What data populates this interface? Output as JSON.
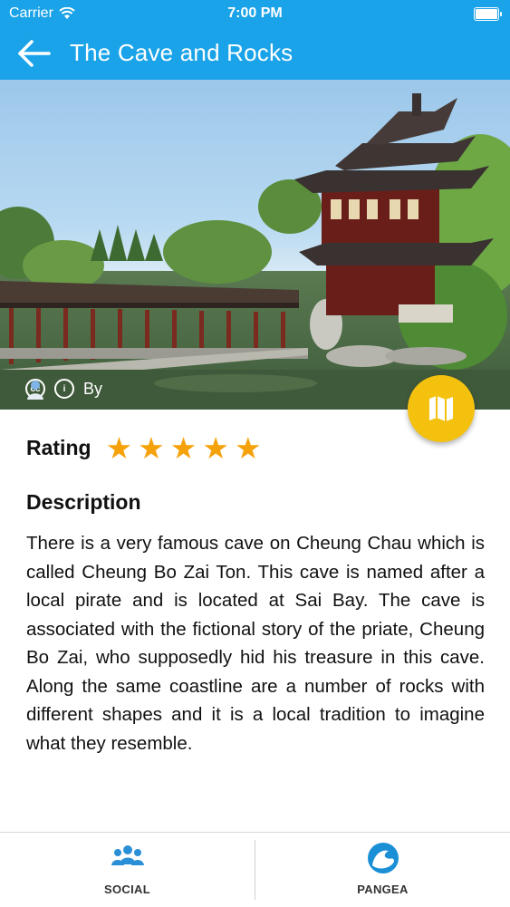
{
  "status_bar": {
    "carrier": "Carrier",
    "time": "7:00 PM",
    "icons": [
      "wifi-icon",
      "battery-icon"
    ]
  },
  "nav": {
    "back_icon": "arrow-left-icon",
    "title": "The Cave and Rocks"
  },
  "hero": {
    "credit_icons": [
      "creative-commons-icon",
      "attribution-icon",
      "author-icon"
    ],
    "credit_text": "By",
    "fab_icon": "map-icon"
  },
  "rating": {
    "label": "Rating",
    "stars": 5,
    "max": 5
  },
  "description": {
    "title": "Description",
    "text": "There is a very famous cave on Cheung Chau which is called Cheung Bo Zai Ton. This cave is named after a local pirate and is located at Sai Bay. The cave is associated with the fictional story of the priate, Cheung Bo Zai, who supposedly hid his treasure in this cave. Along the same coastline are a number of rocks with different shapes and it is a local tradition to imagine what they resemble."
  },
  "tabs": [
    {
      "label": "SOCIAL",
      "icon": "people-icon"
    },
    {
      "label": "PANGEA",
      "icon": "wave-icon"
    }
  ],
  "colors": {
    "primary": "#1aa3e8",
    "accent": "#f5c10f",
    "star": "#f5a20a"
  }
}
